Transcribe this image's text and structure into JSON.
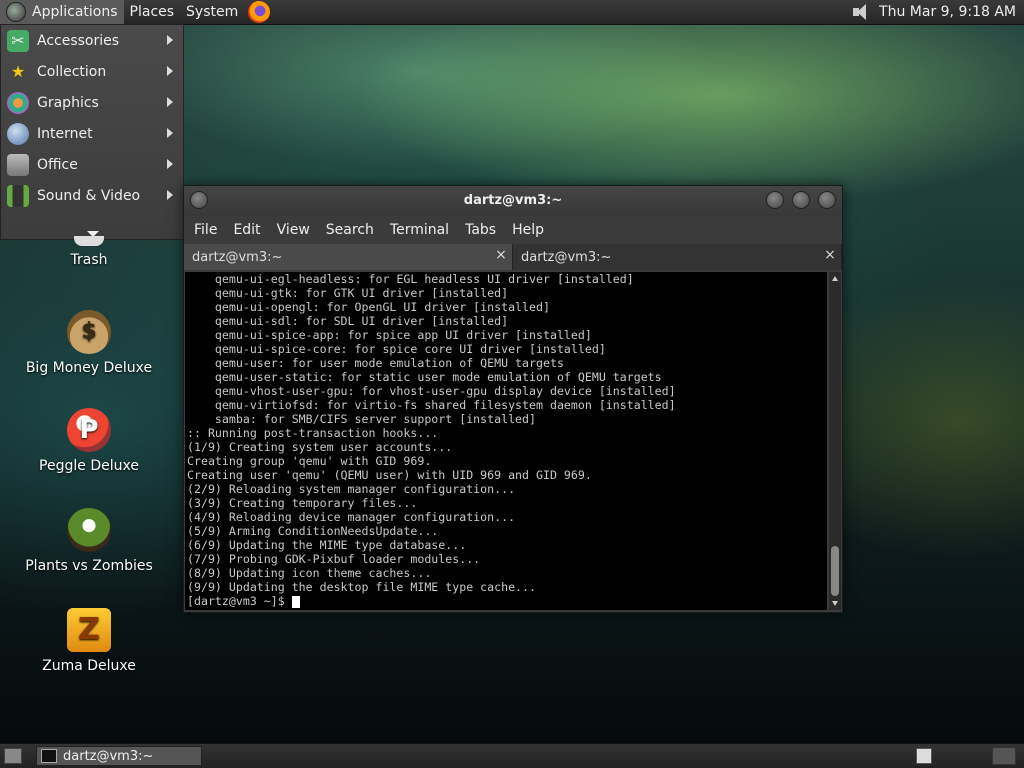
{
  "top_panel": {
    "applications": "Applications",
    "places": "Places",
    "system": "System",
    "clock": "Thu Mar  9,  9:18 AM"
  },
  "app_menu": {
    "items": [
      {
        "label": "Accessories",
        "icon": "tools-icon"
      },
      {
        "label": "Collection",
        "icon": "star-icon"
      },
      {
        "label": "Graphics",
        "icon": "palette-icon"
      },
      {
        "label": "Internet",
        "icon": "globe-icon"
      },
      {
        "label": "Office",
        "icon": "briefcase-icon"
      },
      {
        "label": "Sound & Video",
        "icon": "film-icon"
      }
    ]
  },
  "desktop": {
    "icons": [
      {
        "label": "Trash"
      },
      {
        "label": "Big Money Deluxe"
      },
      {
        "label": "Peggle Deluxe"
      },
      {
        "label": "Plants vs Zombies"
      },
      {
        "label": "Zuma Deluxe"
      }
    ]
  },
  "terminal": {
    "title": "dartz@vm3:~",
    "menu": [
      "File",
      "Edit",
      "View",
      "Search",
      "Terminal",
      "Tabs",
      "Help"
    ],
    "tabs": [
      {
        "label": "dartz@vm3:~",
        "close": "×"
      },
      {
        "label": "dartz@vm3:~",
        "close": "×"
      }
    ],
    "lines": [
      "    qemu-ui-egl-headless: for EGL headless UI driver [installed]",
      "    qemu-ui-gtk: for GTK UI driver [installed]",
      "    qemu-ui-opengl: for OpenGL UI driver [installed]",
      "    qemu-ui-sdl: for SDL UI driver [installed]",
      "    qemu-ui-spice-app: for spice app UI driver [installed]",
      "    qemu-ui-spice-core: for spice core UI driver [installed]",
      "    qemu-user: for user mode emulation of QEMU targets",
      "    qemu-user-static: for static user mode emulation of QEMU targets",
      "    qemu-vhost-user-gpu: for vhost-user-gpu display device [installed]",
      "    qemu-virtiofsd: for virtio-fs shared filesystem daemon [installed]",
      "    samba: for SMB/CIFS server support [installed]",
      ":: Running post-transaction hooks...",
      "(1/9) Creating system user accounts...",
      "Creating group 'qemu' with GID 969.",
      "Creating user 'qemu' (QEMU user) with UID 969 and GID 969.",
      "(2/9) Reloading system manager configuration...",
      "(3/9) Creating temporary files...",
      "(4/9) Reloading device manager configuration...",
      "(5/9) Arming ConditionNeedsUpdate...",
      "(6/9) Updating the MIME type database...",
      "(7/9) Probing GDK-Pixbuf loader modules...",
      "(8/9) Updating icon theme caches...",
      "(9/9) Updating the desktop file MIME type cache..."
    ],
    "prompt": "[dartz@vm3 ~]$ "
  },
  "bottom_panel": {
    "task": "dartz@vm3:~"
  }
}
